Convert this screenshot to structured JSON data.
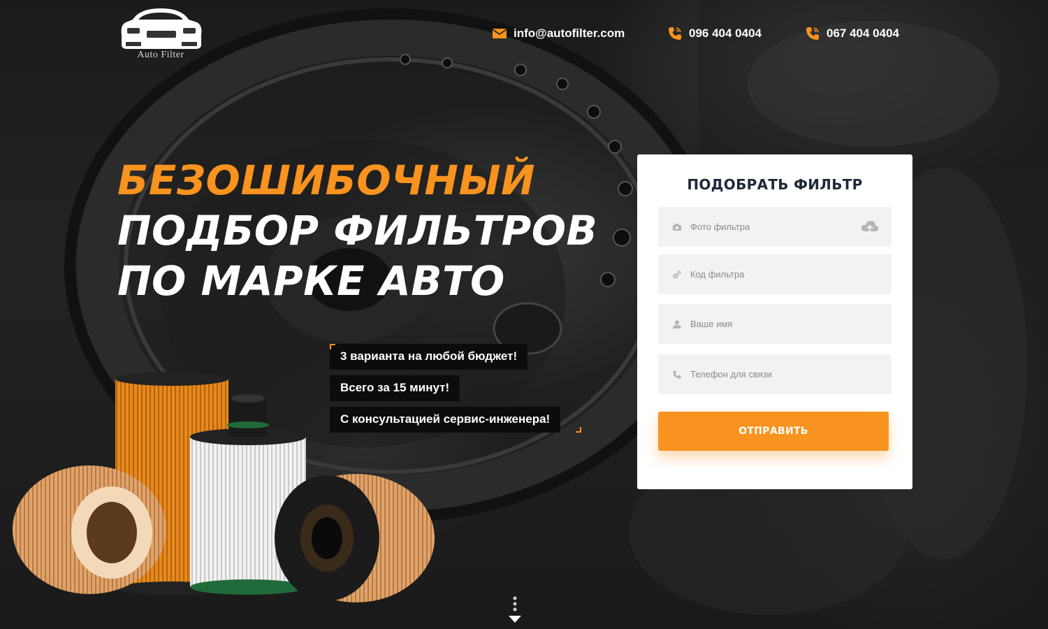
{
  "brand": {
    "logo_text": "Auto Filter"
  },
  "header": {
    "email": "info@autofilter.com",
    "phone_1": "096 404 0404",
    "phone_2": "067 404 0404"
  },
  "hero": {
    "headline_accent": "БЕЗОШИБОЧНЫЙ",
    "headline_line_2": "ПОДБОР ФИЛЬТРОВ",
    "headline_line_3": "ПО МАРКЕ АВТО",
    "features": [
      "3 варианта на любой бюджет!",
      "Всего за 15 минут!",
      "С консультацией сервис-инженера!"
    ]
  },
  "form": {
    "title": "ПОДОБРАТЬ ФИЛЬТР",
    "fields": [
      {
        "placeholder": "Фото фильтра",
        "value": "",
        "icon": "camera-icon"
      },
      {
        "placeholder": "Код фильтра",
        "value": "",
        "icon": "gears-icon"
      },
      {
        "placeholder": "Ваше имя",
        "value": "",
        "icon": "user-icon"
      },
      {
        "placeholder": "Телефон для связи",
        "value": "",
        "icon": "phone-icon"
      }
    ],
    "submit_label": "ОТПРАВИТЬ"
  },
  "colors": {
    "accent": "#f7931e",
    "form_title": "#1d2a3a",
    "field_bg": "#f2f2f2",
    "feature_bg": "#0c0c0c"
  }
}
